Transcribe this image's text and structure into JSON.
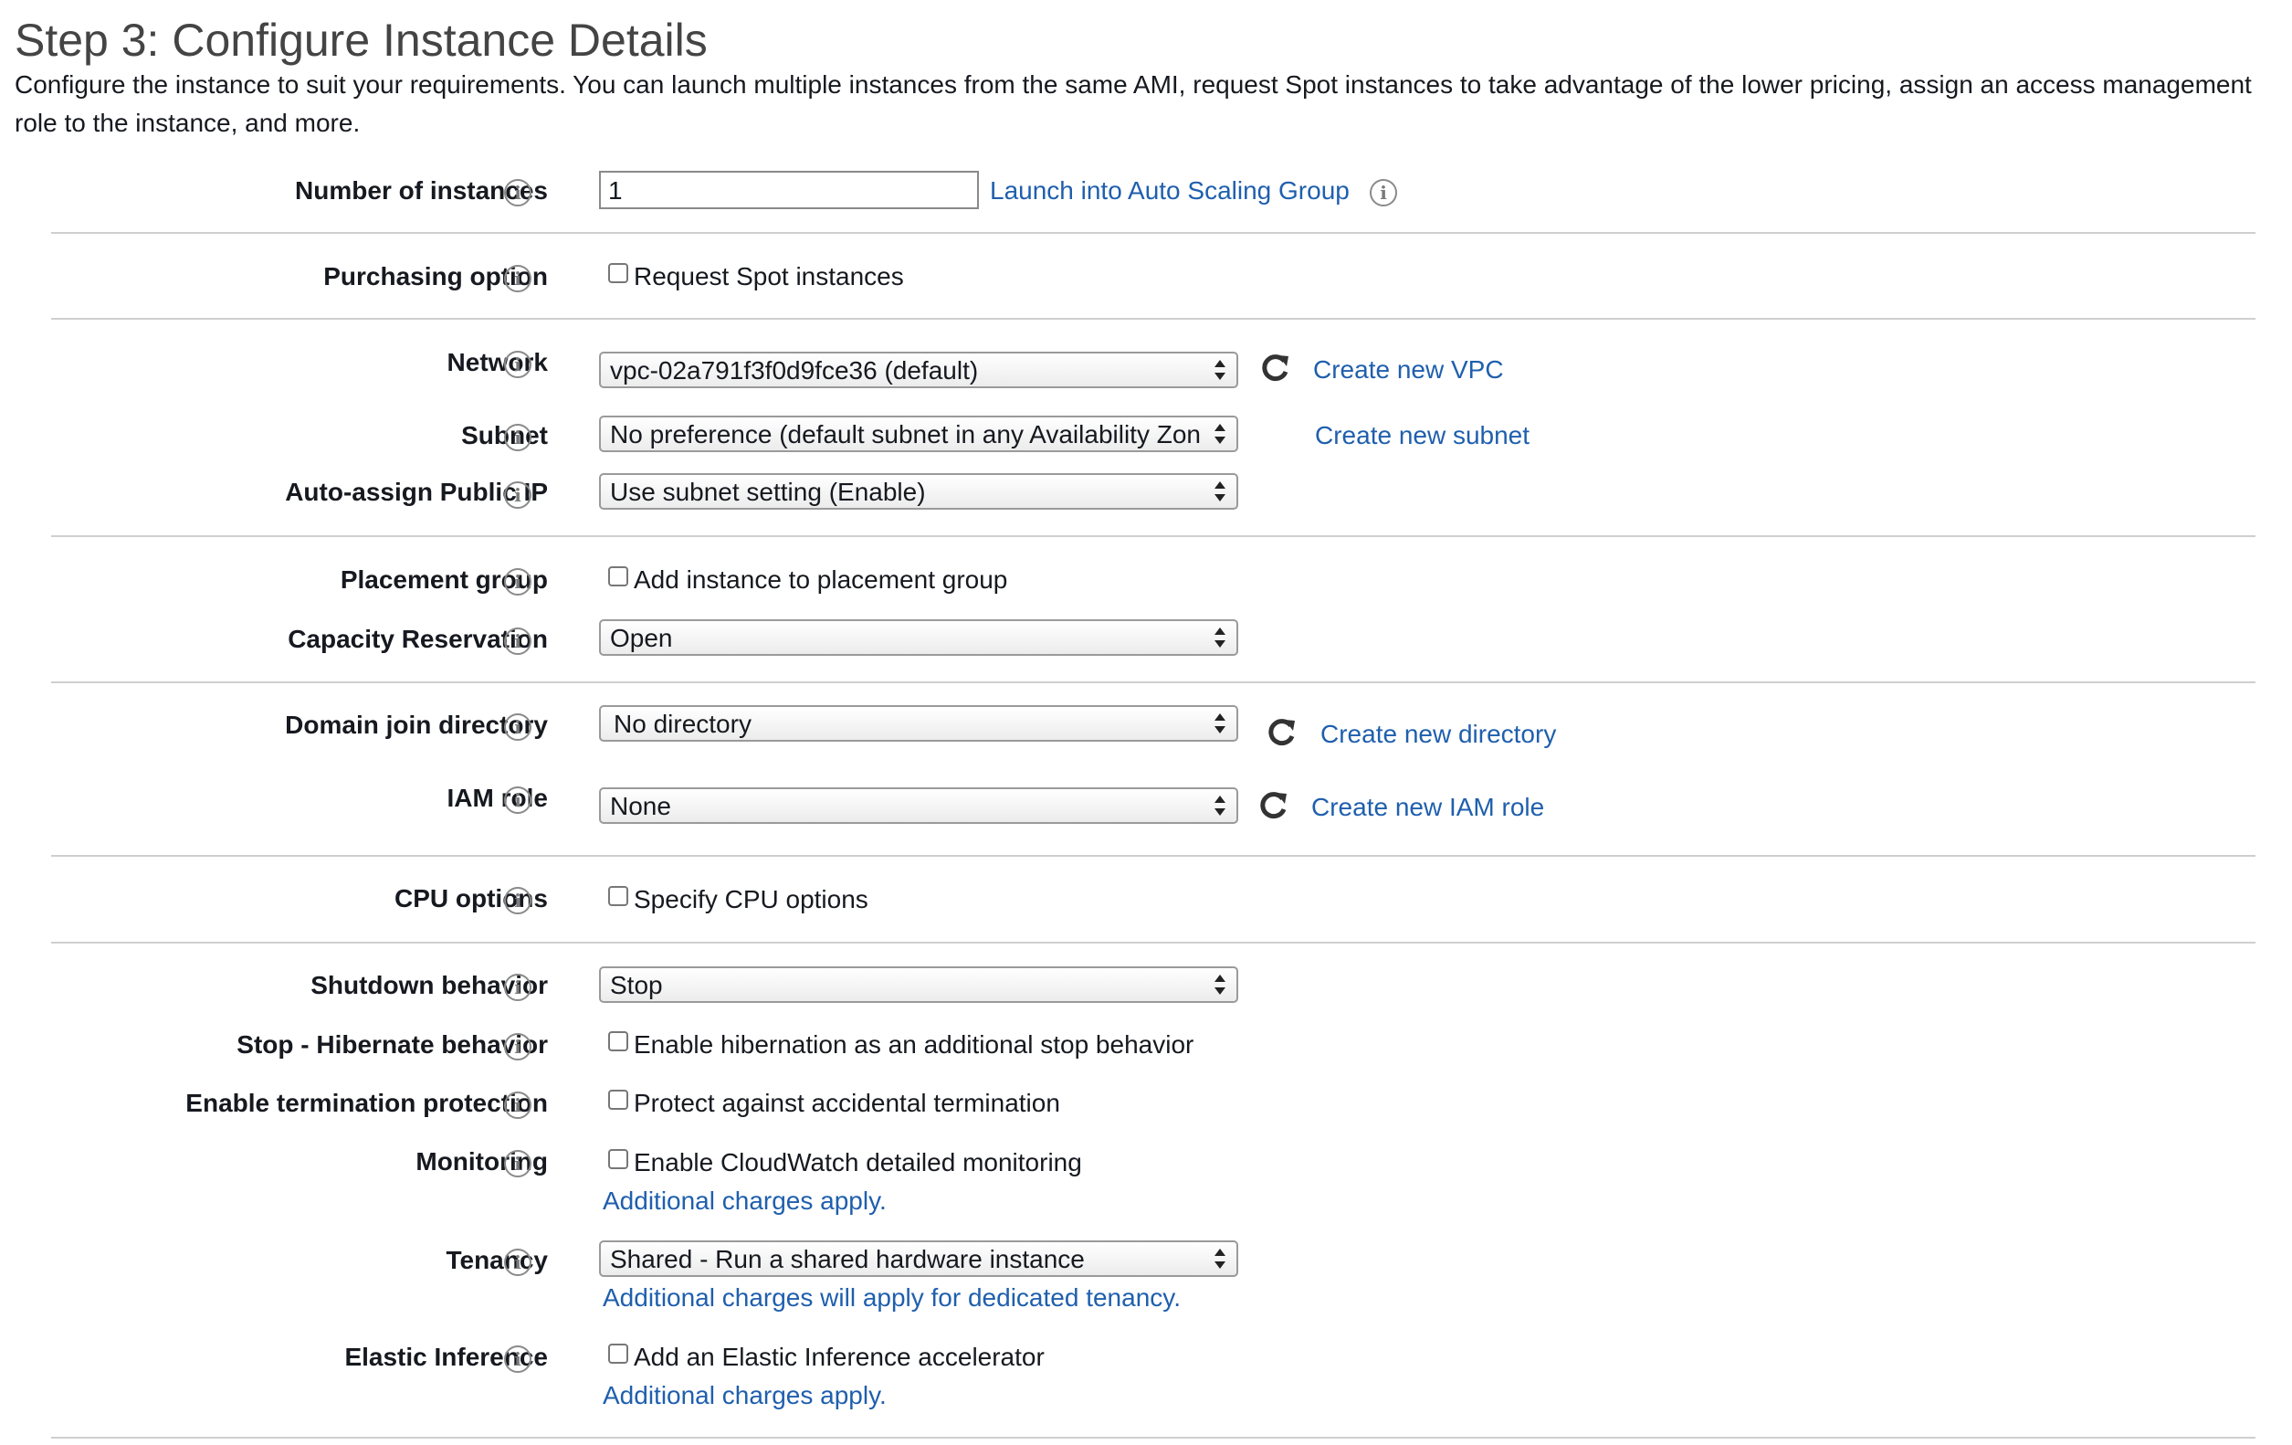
{
  "header": {
    "title": "Step 3: Configure Instance Details",
    "description": "Configure the instance to suit your requirements. You can launch multiple instances from the same AMI, request Spot instances to take advantage of the lower pricing, assign an access management role to the instance, and more."
  },
  "fields": {
    "number_of_instances": {
      "label": "Number of instances",
      "value": "1",
      "link": "Launch into Auto Scaling Group"
    },
    "purchasing_option": {
      "label": "Purchasing option",
      "checkbox": "Request Spot instances"
    },
    "network": {
      "label": "Network",
      "value": "vpc-02a791f3f0d9fce36 (default)",
      "link": "Create new VPC"
    },
    "subnet": {
      "label": "Subnet",
      "value": "No preference (default subnet in any Availability Zone)",
      "link": "Create new subnet"
    },
    "auto_assign_ip": {
      "label": "Auto-assign Public IP",
      "value": "Use subnet setting (Enable)"
    },
    "placement_group": {
      "label": "Placement group",
      "checkbox": "Add instance to placement group"
    },
    "capacity_reservation": {
      "label": "Capacity Reservation",
      "value": "Open"
    },
    "domain_join": {
      "label": "Domain join directory",
      "value": "No directory",
      "link": "Create new directory"
    },
    "iam_role": {
      "label": "IAM role",
      "value": "None",
      "link": "Create new IAM role"
    },
    "cpu_options": {
      "label": "CPU options",
      "checkbox": "Specify CPU options"
    },
    "shutdown_behavior": {
      "label": "Shutdown behavior",
      "value": "Stop"
    },
    "stop_hibernate": {
      "label": "Stop - Hibernate behavior",
      "checkbox": "Enable hibernation as an additional stop behavior"
    },
    "termination_protection": {
      "label": "Enable termination protection",
      "checkbox": "Protect against accidental termination"
    },
    "monitoring": {
      "label": "Monitoring",
      "checkbox": "Enable CloudWatch detailed monitoring",
      "note": "Additional charges apply."
    },
    "tenancy": {
      "label": "Tenancy",
      "value": "Shared - Run a shared hardware instance",
      "note": "Additional charges will apply for dedicated tenancy."
    },
    "elastic_inference": {
      "label": "Elastic Inference",
      "checkbox": "Add an Elastic Inference accelerator",
      "note": "Additional charges apply."
    }
  },
  "icons": {
    "info": "info-icon",
    "refresh": "refresh-icon",
    "select_arrows": "select-arrows-icon"
  }
}
